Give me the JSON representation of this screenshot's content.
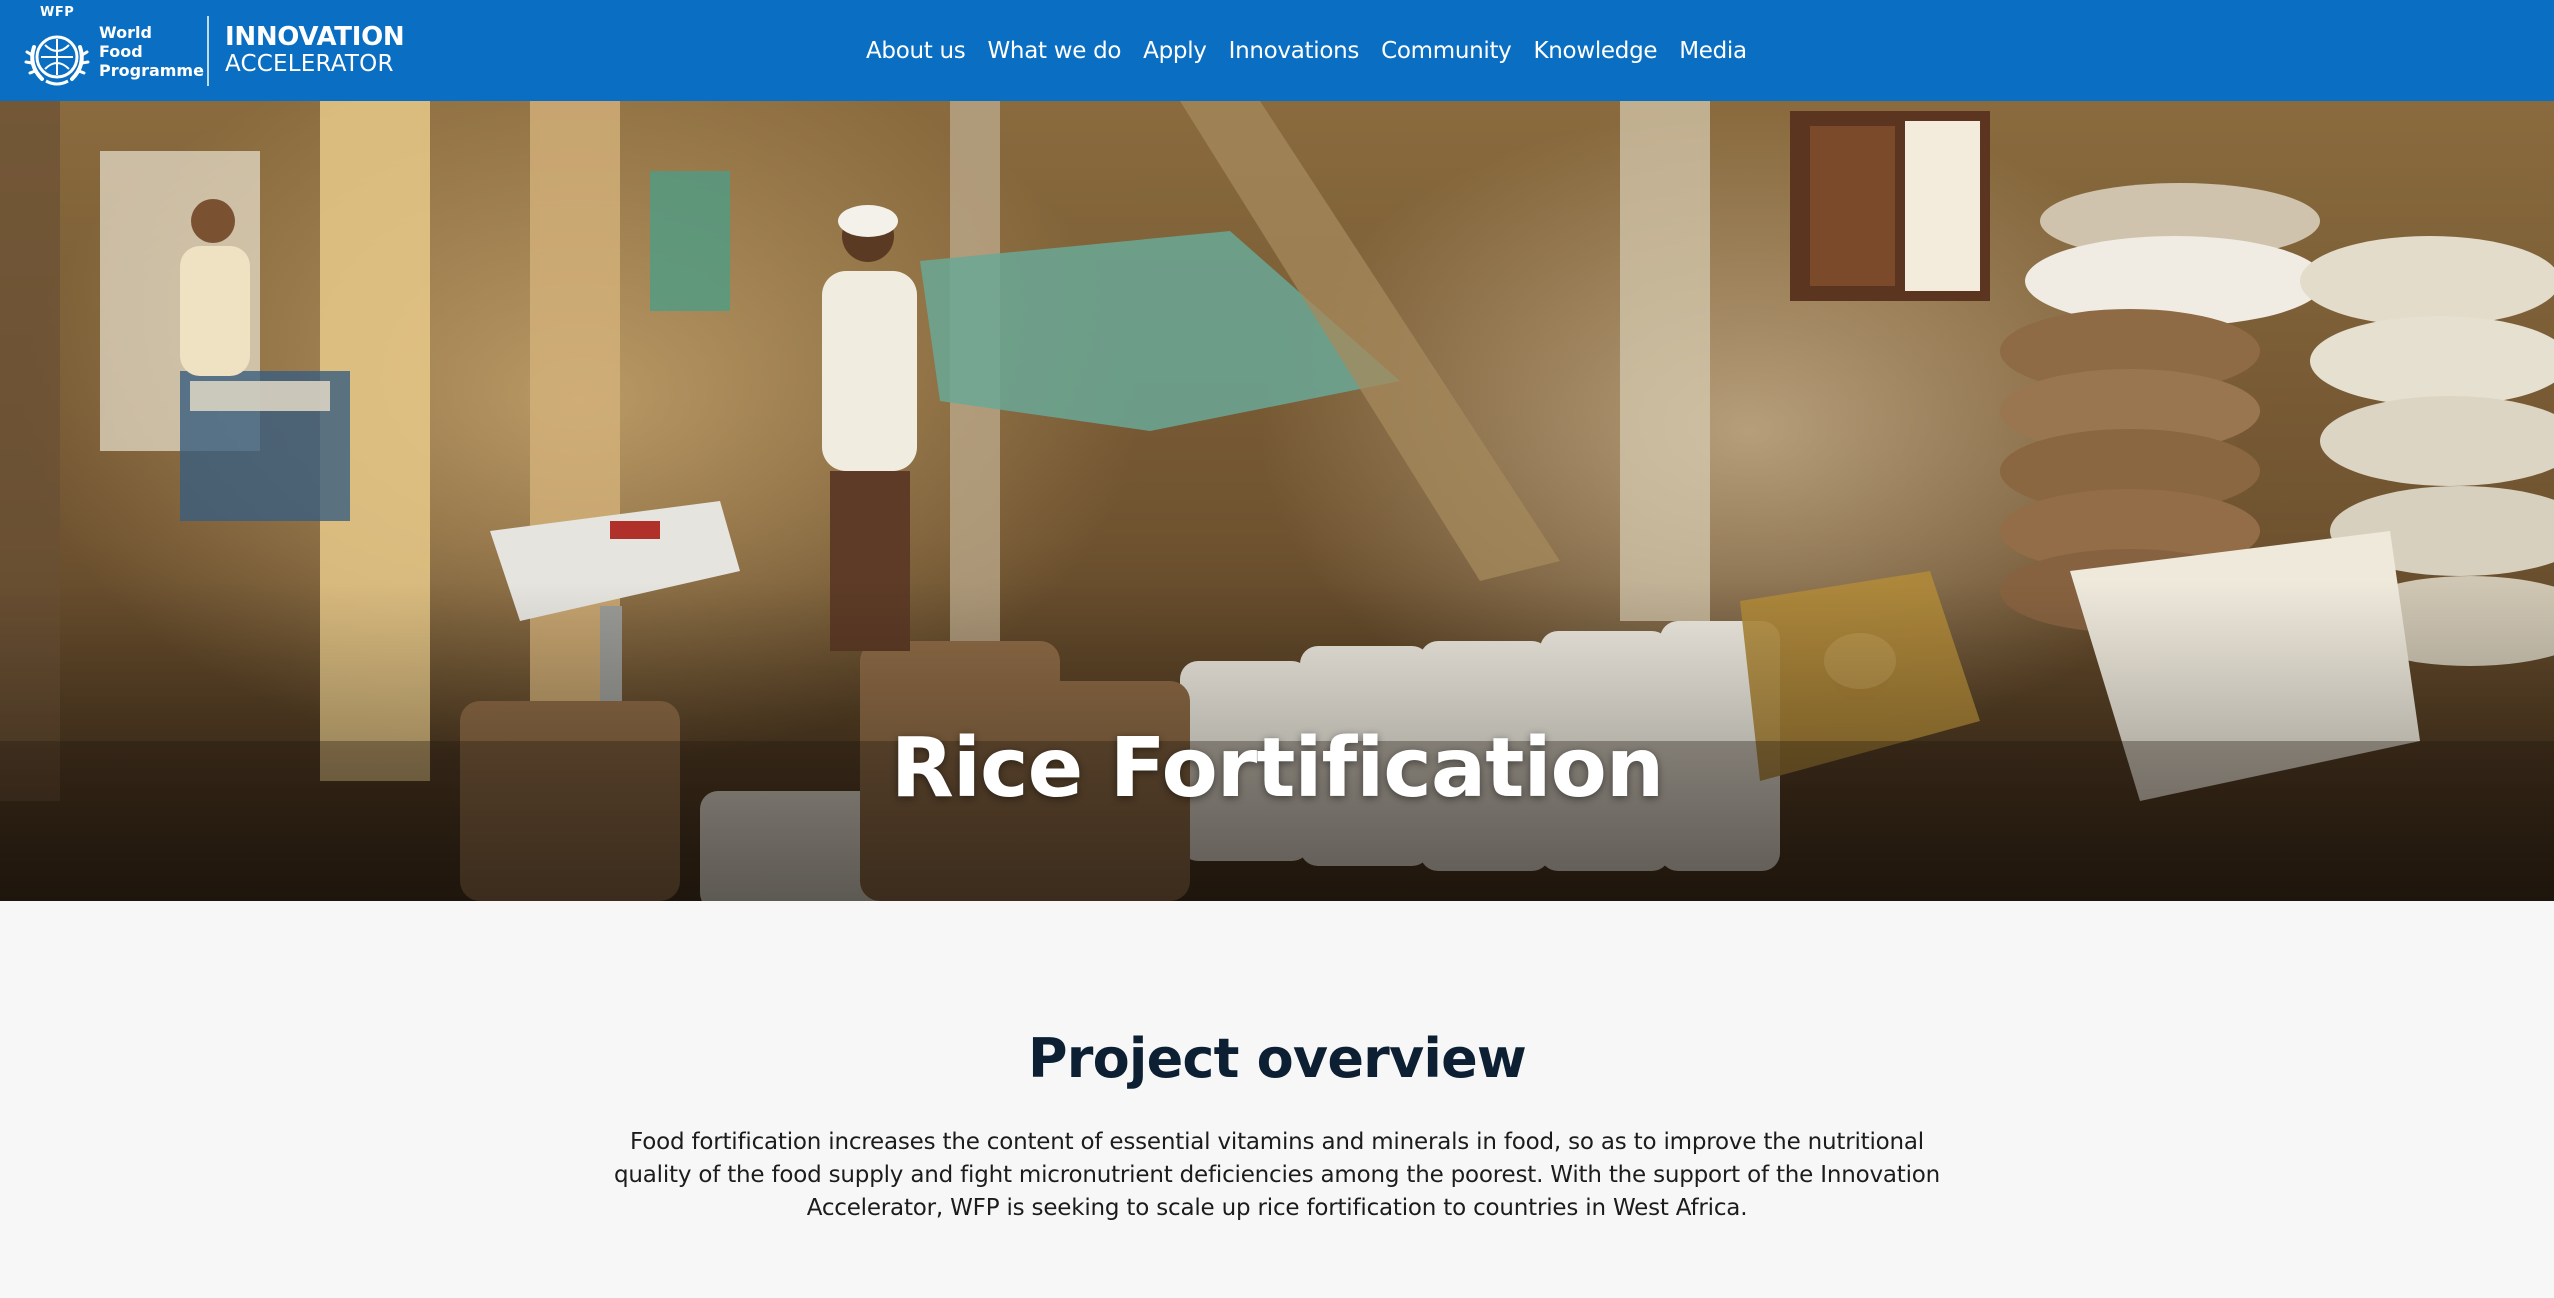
{
  "brand": {
    "tag": "WFP",
    "org_line1": "World Food",
    "org_line2": "Programme",
    "product_line1": "INNOVATION",
    "product_line2": "ACCELERATOR"
  },
  "nav": {
    "items": [
      "About us",
      "What we do",
      "Apply",
      "Innovations",
      "Community",
      "Knowledge",
      "Media"
    ]
  },
  "hero": {
    "title": "Rice Fortification"
  },
  "overview": {
    "title": "Project overview",
    "body": "Food fortification increases the content of essential vitamins and minerals in food, so as to improve the nutritional quality of the food supply and fight micronutrient deficiencies among the poorest. With the support of the Innovation Accelerator, WFP is seeking to scale up rice fortification to countries in West Africa."
  },
  "colors": {
    "header_bg": "#0a6fc2",
    "page_bg": "#f7f7f7",
    "heading": "#0d1f33"
  },
  "icons": {
    "emblem": "wfp-wheat-wreath-icon"
  }
}
